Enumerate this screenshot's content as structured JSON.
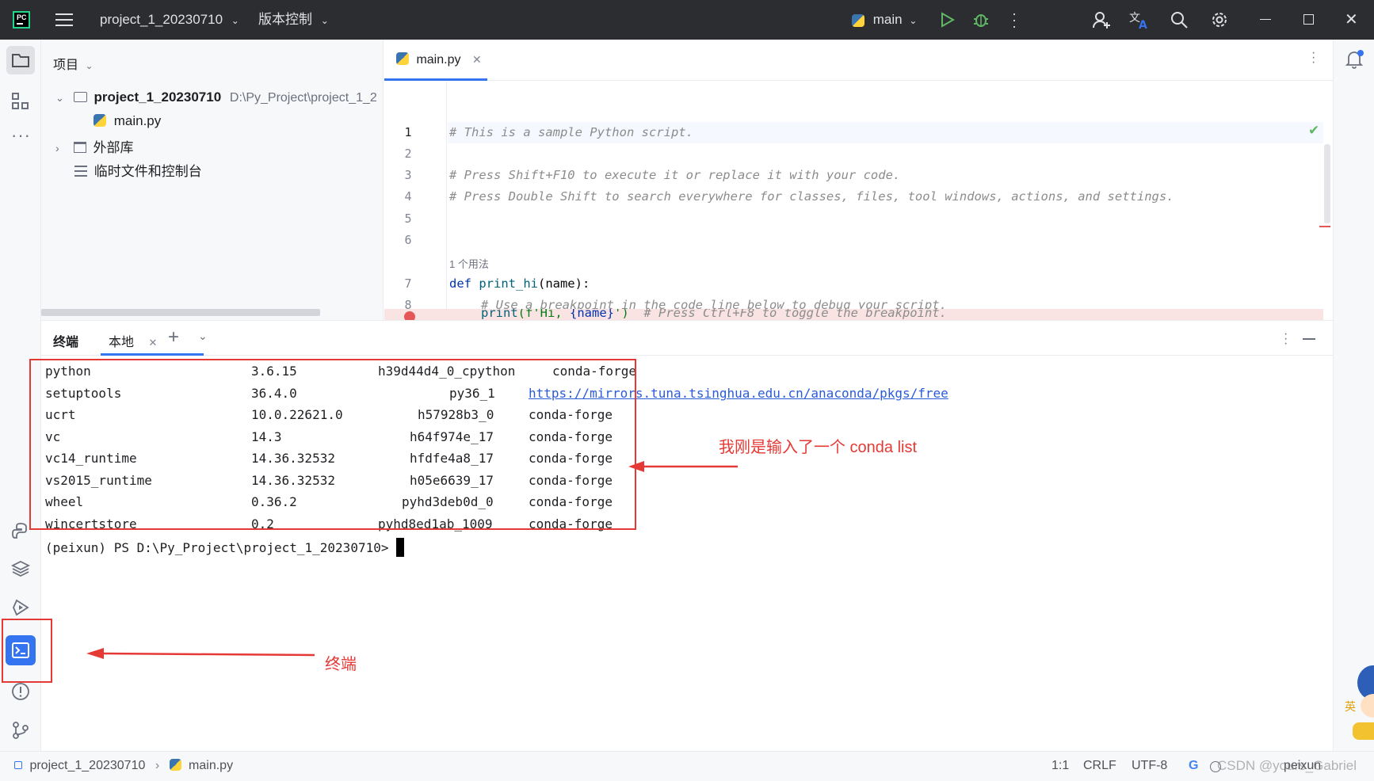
{
  "titlebar": {
    "project": "project_1_20230710",
    "vcs": "版本控制",
    "branch": "main"
  },
  "project_panel": {
    "title": "项目",
    "root_name": "project_1_20230710",
    "root_path": "D:\\Py_Project\\project_1_2",
    "file": "main.py",
    "external": "外部库",
    "scratches": "临时文件和控制台"
  },
  "editor": {
    "tab": "main.py",
    "usage_hint": "1 个用法",
    "lines": {
      "l1": "# This is a sample Python script.",
      "l3": "# Press Shift+F10 to execute it or replace it with your code.",
      "l4": "# Press Double Shift to search everywhere for classes, files, tool windows, actions, and settings.",
      "l7_kw": "def ",
      "l7_fn": "print_hi",
      "l7_rest": "(name):",
      "l8": "# Use a breakpoint in the code line below to debug your script.",
      "l9_fn": "print",
      "l9_str1": "(f'Hi, ",
      "l9_var": "{name}",
      "l9_str2": "')",
      "l9_cm": "# Press Ctrl+F8 to toggle the breakpoint."
    },
    "line_numbers": [
      "1",
      "2",
      "3",
      "4",
      "5",
      "6",
      "7",
      "8"
    ]
  },
  "terminal": {
    "tab_title": "终端",
    "session": "本地",
    "rows": [
      {
        "name": "python",
        "version": "3.6.15",
        "build": "h39d44d4_0_cpython",
        "channel": "conda-forge"
      },
      {
        "name": "setuptools",
        "version": "36.4.0",
        "build": "py36_1",
        "channel": "https://mirrors.tuna.tsinghua.edu.cn/anaconda/pkgs/free"
      },
      {
        "name": "ucrt",
        "version": "10.0.22621.0",
        "build": "h57928b3_0",
        "channel": "conda-forge"
      },
      {
        "name": "vc",
        "version": "14.3",
        "build": "h64f974e_17",
        "channel": "conda-forge"
      },
      {
        "name": "vc14_runtime",
        "version": "14.36.32532",
        "build": "hfdfe4a8_17",
        "channel": "conda-forge"
      },
      {
        "name": "vs2015_runtime",
        "version": "14.36.32532",
        "build": "h05e6639_17",
        "channel": "conda-forge"
      },
      {
        "name": "wheel",
        "version": "0.36.2",
        "build": "pyhd3deb0d_0",
        "channel": "conda-forge"
      },
      {
        "name": "wincertstore",
        "version": "0.2",
        "build": "pyhd8ed1ab_1009",
        "channel": "conda-forge"
      }
    ],
    "prompt": "(peixun) PS D:\\Py_Project\\project_1_20230710>"
  },
  "annotations": {
    "conda_note": "我刚是输入了一个 conda list",
    "terminal_note": "终端"
  },
  "statusbar": {
    "crumb_project": "project_1_20230710",
    "crumb_file": "main.py",
    "position": "1:1",
    "line_sep": "CRLF",
    "encoding": "UTF-8",
    "watermark": "CSDN @yours_Gabriel",
    "interpreter": "peixun"
  },
  "colors": {
    "accent": "#3574f0",
    "annotation": "#e53935"
  }
}
